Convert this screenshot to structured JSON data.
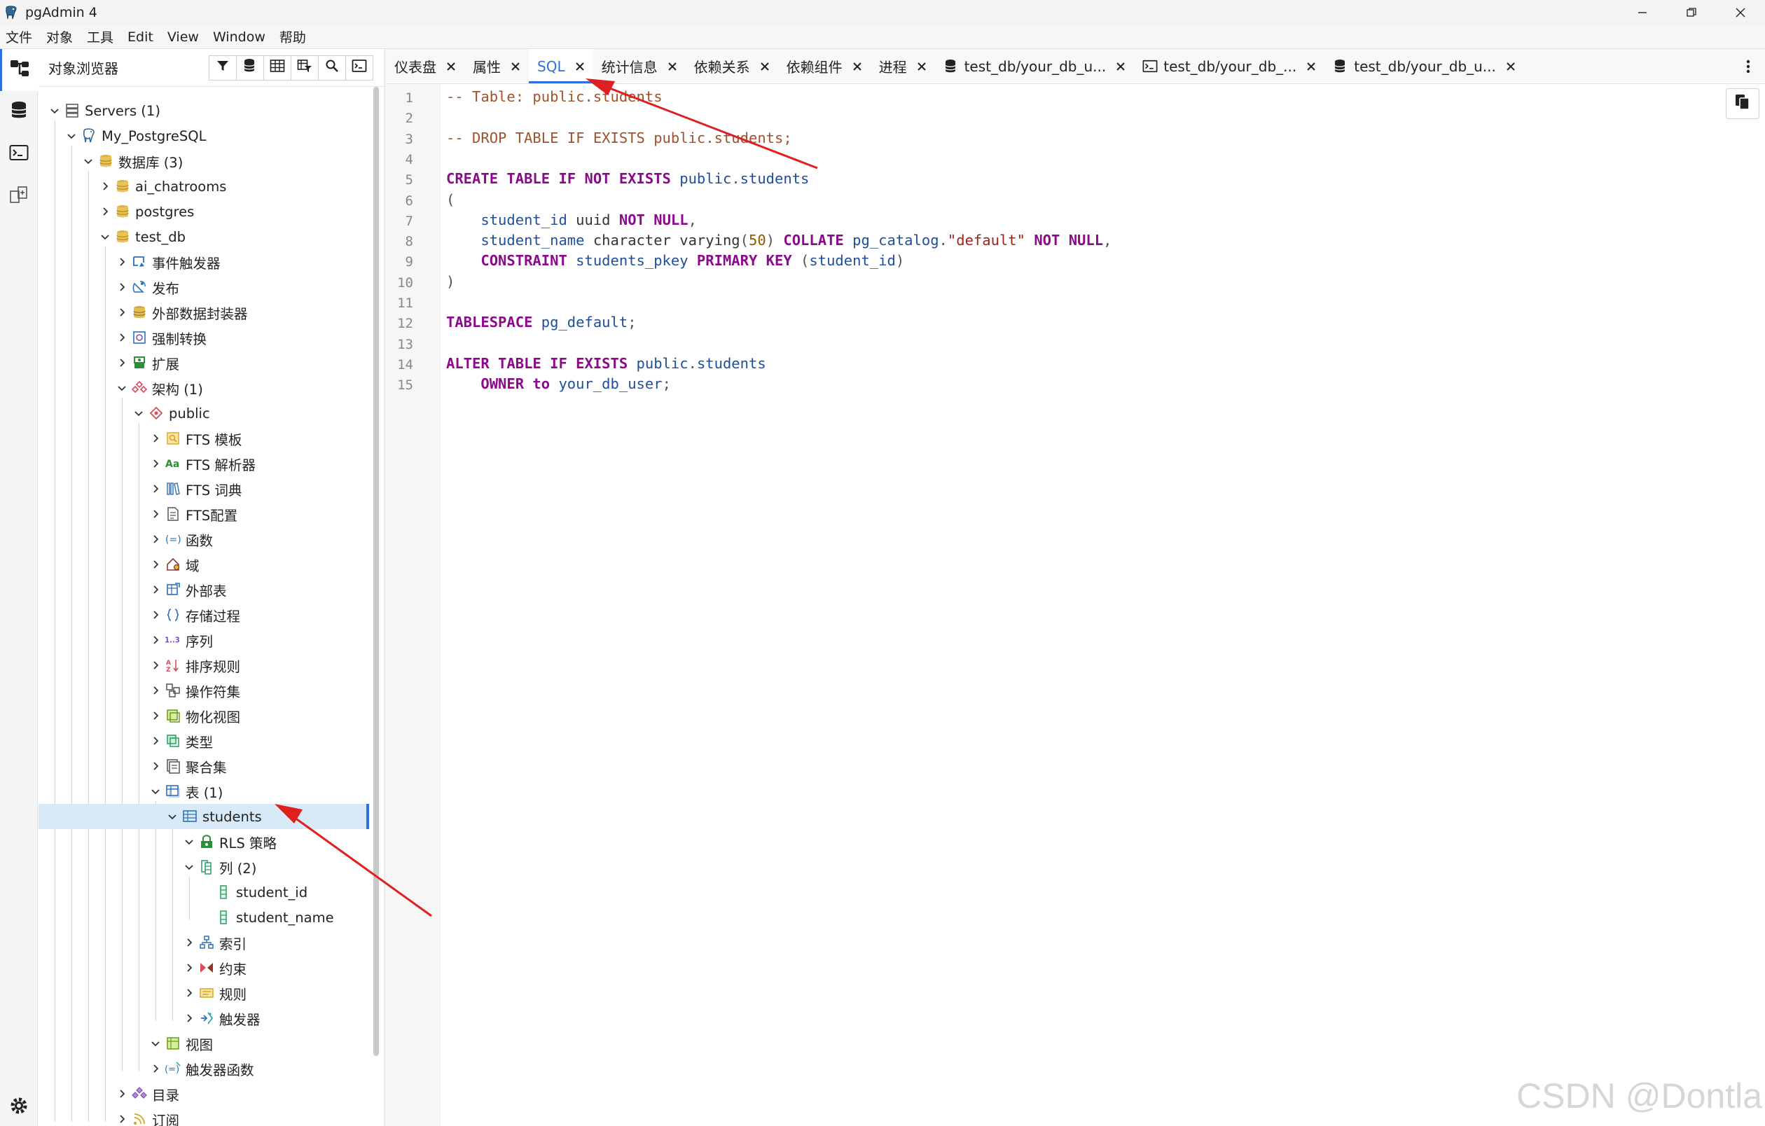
{
  "window": {
    "title": "pgAdmin 4"
  },
  "menu": [
    "文件",
    "对象",
    "工具",
    "Edit",
    "View",
    "Window",
    "帮助"
  ],
  "browser": {
    "title": "对象浏览器",
    "tree": [
      {
        "label": "Servers (1)",
        "depth": 0,
        "state": "open",
        "icon": "servers-icon"
      },
      {
        "label": "My_PostgreSQL",
        "depth": 1,
        "state": "open",
        "icon": "postgres-elephant-icon"
      },
      {
        "label": "数据库 (3)",
        "depth": 2,
        "state": "open",
        "icon": "databases-icon"
      },
      {
        "label": "ai_chatrooms",
        "depth": 3,
        "state": "closed",
        "icon": "database-icon"
      },
      {
        "label": "postgres",
        "depth": 3,
        "state": "closed",
        "icon": "database-icon"
      },
      {
        "label": "test_db",
        "depth": 3,
        "state": "open",
        "icon": "database-icon"
      },
      {
        "label": "事件触发器",
        "depth": 4,
        "state": "closed",
        "icon": "event-trigger-icon"
      },
      {
        "label": "发布",
        "depth": 4,
        "state": "closed",
        "icon": "publication-icon"
      },
      {
        "label": "外部数据封装器",
        "depth": 4,
        "state": "closed",
        "icon": "foreign-data-wrapper-icon"
      },
      {
        "label": "强制转换",
        "depth": 4,
        "state": "closed",
        "icon": "cast-icon"
      },
      {
        "label": "扩展",
        "depth": 4,
        "state": "closed",
        "icon": "extension-icon"
      },
      {
        "label": "架构 (1)",
        "depth": 4,
        "state": "open",
        "icon": "schemas-icon"
      },
      {
        "label": "public",
        "depth": 5,
        "state": "open",
        "icon": "schema-icon"
      },
      {
        "label": "FTS 模板",
        "depth": 6,
        "state": "closed",
        "icon": "fts-template-icon"
      },
      {
        "label": "FTS 解析器",
        "depth": 6,
        "state": "closed",
        "icon": "fts-parser-icon"
      },
      {
        "label": "FTS 词典",
        "depth": 6,
        "state": "closed",
        "icon": "fts-dictionary-icon"
      },
      {
        "label": "FTS配置",
        "depth": 6,
        "state": "closed",
        "icon": "fts-configuration-icon"
      },
      {
        "label": "函数",
        "depth": 6,
        "state": "closed",
        "icon": "function-icon"
      },
      {
        "label": "域",
        "depth": 6,
        "state": "closed",
        "icon": "domain-icon"
      },
      {
        "label": "外部表",
        "depth": 6,
        "state": "closed",
        "icon": "foreign-table-icon"
      },
      {
        "label": "存储过程",
        "depth": 6,
        "state": "closed",
        "icon": "procedure-icon"
      },
      {
        "label": "序列",
        "depth": 6,
        "state": "closed",
        "icon": "sequence-icon"
      },
      {
        "label": "排序规则",
        "depth": 6,
        "state": "closed",
        "icon": "collation-icon"
      },
      {
        "label": "操作符集",
        "depth": 6,
        "state": "closed",
        "icon": "operator-family-icon"
      },
      {
        "label": "物化视图",
        "depth": 6,
        "state": "closed",
        "icon": "materialized-view-icon"
      },
      {
        "label": "类型",
        "depth": 6,
        "state": "closed",
        "icon": "type-icon"
      },
      {
        "label": "聚合集",
        "depth": 6,
        "state": "closed",
        "icon": "aggregate-icon"
      },
      {
        "label": "表 (1)",
        "depth": 6,
        "state": "open",
        "icon": "tables-icon"
      },
      {
        "label": "students",
        "depth": 7,
        "state": "open",
        "icon": "table-icon",
        "selected": true
      },
      {
        "label": "RLS 策略",
        "depth": 8,
        "state": "open",
        "icon": "rls-policy-icon"
      },
      {
        "label": "列 (2)",
        "depth": 8,
        "state": "open",
        "icon": "columns-icon"
      },
      {
        "label": "student_id",
        "depth": 9,
        "state": "leaf",
        "icon": "column-icon"
      },
      {
        "label": "student_name",
        "depth": 9,
        "state": "leaf",
        "icon": "column-icon"
      },
      {
        "label": "索引",
        "depth": 8,
        "state": "closed",
        "icon": "index-icon"
      },
      {
        "label": "约束",
        "depth": 8,
        "state": "closed",
        "icon": "constraint-icon"
      },
      {
        "label": "规则",
        "depth": 8,
        "state": "closed",
        "icon": "rule-icon"
      },
      {
        "label": "触发器",
        "depth": 8,
        "state": "closed",
        "icon": "trigger-icon"
      },
      {
        "label": "视图",
        "depth": 6,
        "state": "open",
        "icon": "view-icon"
      },
      {
        "label": "触发器函数",
        "depth": 6,
        "state": "closed",
        "icon": "trigger-function-icon"
      },
      {
        "label": "目录",
        "depth": 4,
        "state": "closed",
        "icon": "catalog-icon"
      },
      {
        "label": "订阅",
        "depth": 4,
        "state": "closed",
        "icon": "subscription-icon"
      }
    ]
  },
  "tabs": [
    {
      "label": "仪表盘",
      "icon": null
    },
    {
      "label": "属性",
      "icon": null
    },
    {
      "label": "SQL",
      "icon": null,
      "active": true
    },
    {
      "label": "统计信息",
      "icon": null
    },
    {
      "label": "依赖关系",
      "icon": null
    },
    {
      "label": "依赖组件",
      "icon": null
    },
    {
      "label": "进程",
      "icon": null
    },
    {
      "label": "test_db/your_db_u...",
      "icon": "query-tool-icon"
    },
    {
      "label": "test_db/your_db_...",
      "icon": "psql-terminal-icon"
    },
    {
      "label": "test_db/your_db_u...",
      "icon": "query-tool-icon"
    }
  ],
  "editor": {
    "lines": [
      [
        [
          "cm",
          "-- Table: public.students"
        ]
      ],
      [],
      [
        [
          "cm",
          "-- DROP TABLE IF EXISTS public.students;"
        ]
      ],
      [],
      [
        [
          "kw",
          "CREATE TABLE IF NOT EXISTS "
        ],
        [
          "id",
          "public"
        ],
        [
          "pn",
          "."
        ],
        [
          "id",
          "students"
        ]
      ],
      [
        [
          "pn",
          "("
        ]
      ],
      [
        [
          "ty",
          "    "
        ],
        [
          "id",
          "student_id"
        ],
        [
          "ty",
          " uuid "
        ],
        [
          "kw",
          "NOT NULL"
        ],
        [
          "pn",
          ","
        ]
      ],
      [
        [
          "ty",
          "    "
        ],
        [
          "id",
          "student_name"
        ],
        [
          "ty",
          " character varying"
        ],
        [
          "pn",
          "("
        ],
        [
          "num",
          "50"
        ],
        [
          "pn",
          ") "
        ],
        [
          "kw",
          "COLLATE "
        ],
        [
          "id",
          "pg_catalog"
        ],
        [
          "pn",
          "."
        ],
        [
          "str",
          "\"default\""
        ],
        [
          "kw",
          " NOT NULL"
        ],
        [
          "pn",
          ","
        ]
      ],
      [
        [
          "ty",
          "    "
        ],
        [
          "kw",
          "CONSTRAINT "
        ],
        [
          "id",
          "students_pkey"
        ],
        [
          "kw",
          " PRIMARY KEY "
        ],
        [
          "pn",
          "("
        ],
        [
          "id",
          "student_id"
        ],
        [
          "pn",
          ")"
        ]
      ],
      [
        [
          "pn",
          ")"
        ]
      ],
      [],
      [
        [
          "kw",
          "TABLESPACE "
        ],
        [
          "id",
          "pg_default"
        ],
        [
          "pn",
          ";"
        ]
      ],
      [],
      [
        [
          "kw",
          "ALTER TABLE IF EXISTS "
        ],
        [
          "id",
          "public"
        ],
        [
          "pn",
          "."
        ],
        [
          "id",
          "students"
        ]
      ],
      [
        [
          "ty",
          "    "
        ],
        [
          "kw",
          "OWNER to "
        ],
        [
          "id",
          "your_db_user"
        ],
        [
          "pn",
          ";"
        ]
      ]
    ]
  },
  "watermark": "CSDN @Dontla",
  "colors": {
    "accent": "#326fde",
    "selected_row": "#d8eaf8",
    "annotation_arrow": "#e02020"
  }
}
